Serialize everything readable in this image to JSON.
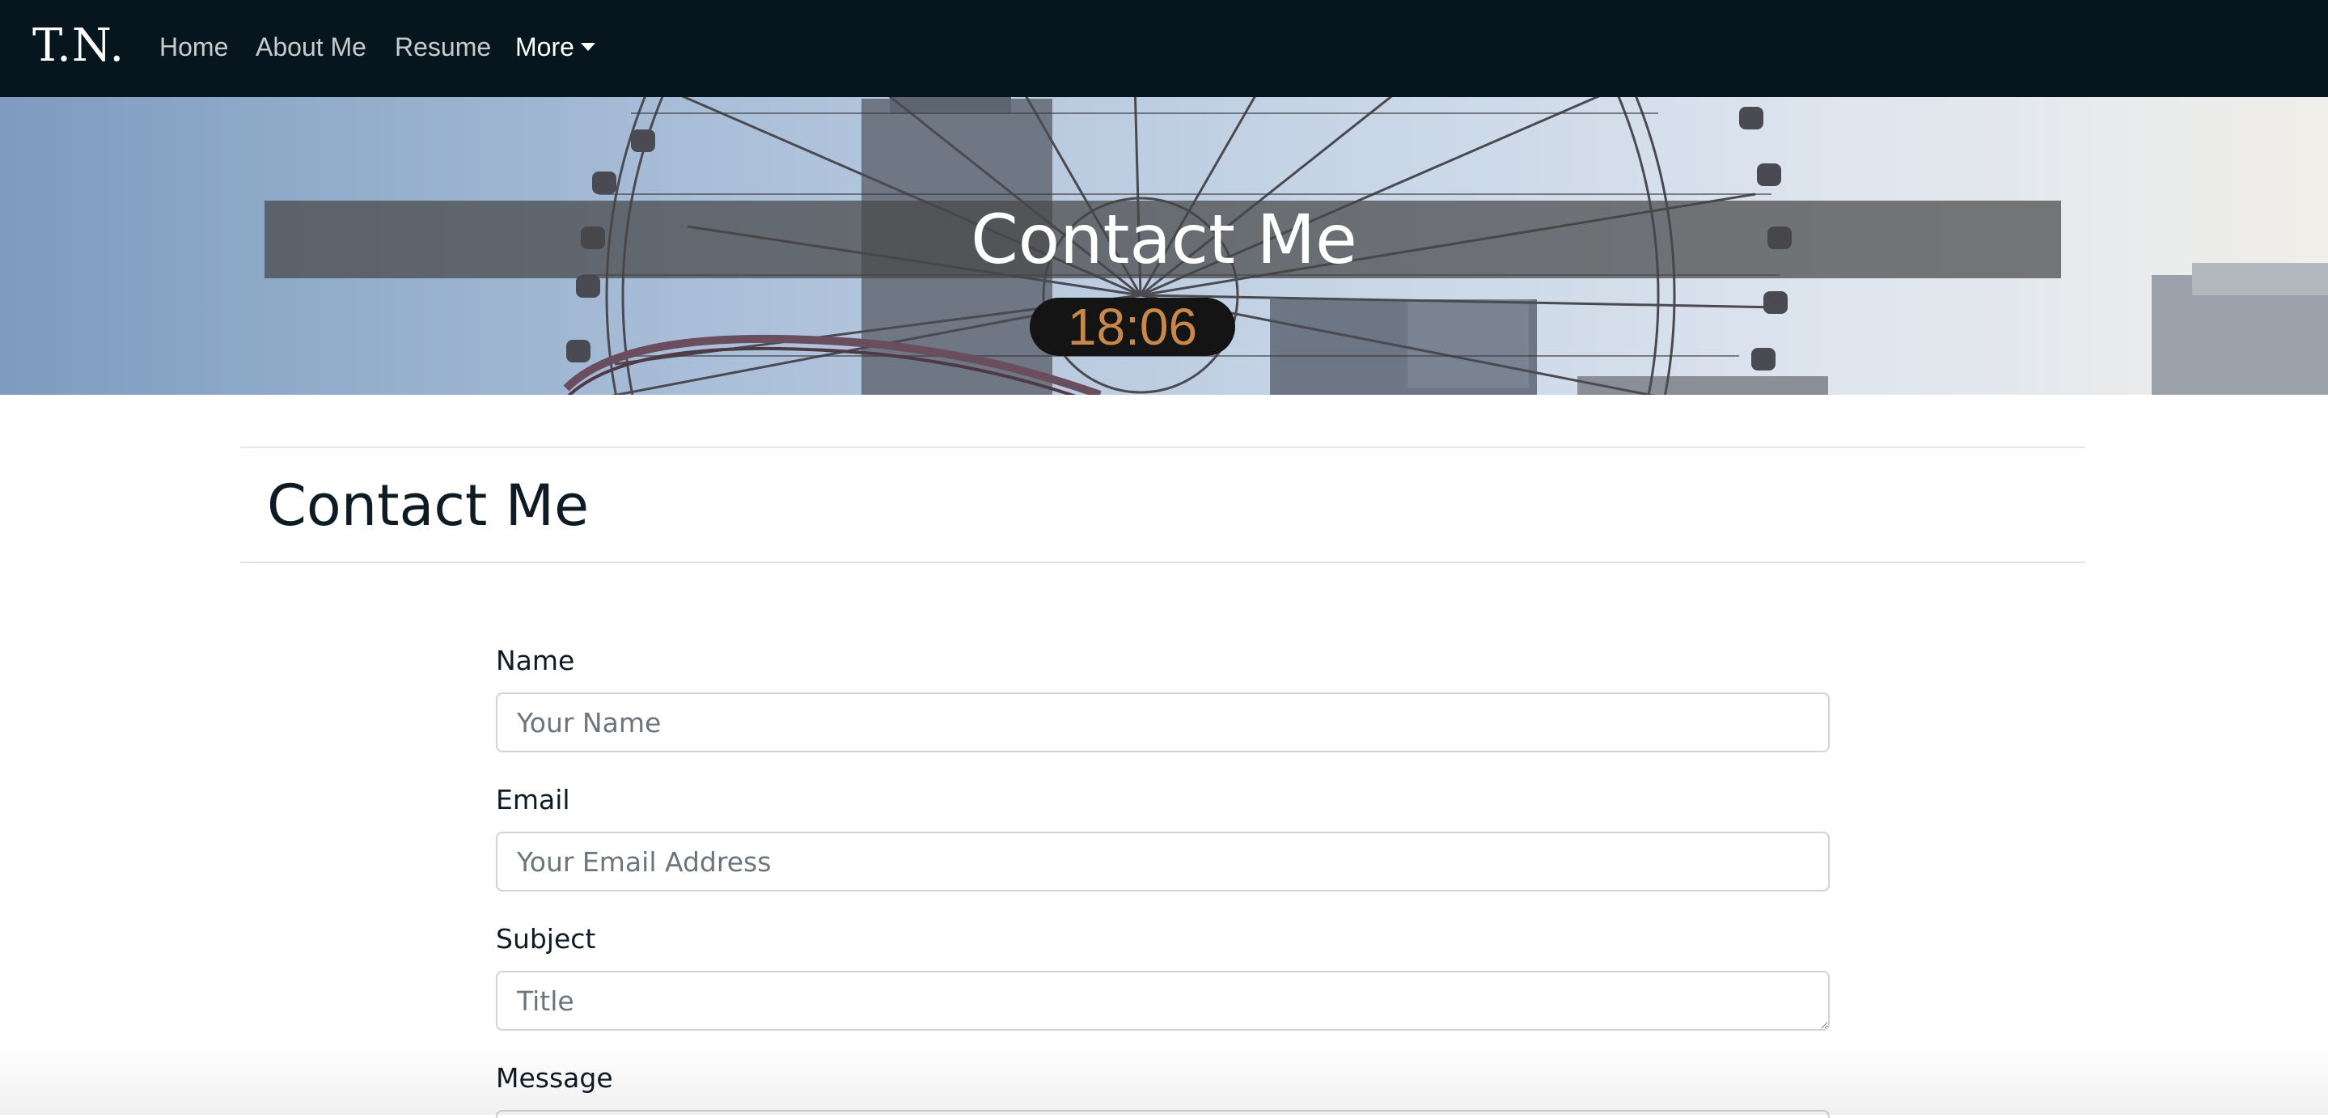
{
  "nav": {
    "brand": "T.N.",
    "links": [
      "Home",
      "About Me",
      "Resume"
    ],
    "more_label": "More"
  },
  "hero": {
    "title": "Contact Me",
    "clock": "18:06"
  },
  "section": {
    "title": "Contact Me"
  },
  "form": {
    "name_label": "Name",
    "name_placeholder": "Your Name",
    "email_label": "Email",
    "email_placeholder": "Your Email Address",
    "subject_label": "Subject",
    "subject_placeholder": "Title",
    "message_label": "Message"
  },
  "colors": {
    "navbar": "#07151e",
    "text": "#0d1b24",
    "clock_digits": "#c8884b"
  }
}
